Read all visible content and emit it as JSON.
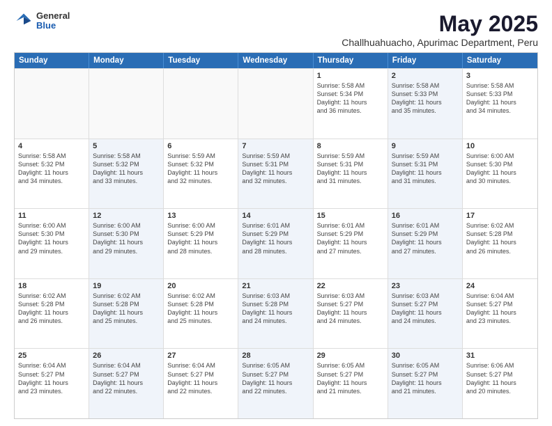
{
  "logo": {
    "general": "General",
    "blue": "Blue"
  },
  "title": "May 2025",
  "subtitle": "Challhuahuacho, Apurimac Department, Peru",
  "header_days": [
    "Sunday",
    "Monday",
    "Tuesday",
    "Wednesday",
    "Thursday",
    "Friday",
    "Saturday"
  ],
  "rows": [
    [
      {
        "day": "",
        "info": "",
        "empty": true
      },
      {
        "day": "",
        "info": "",
        "empty": true
      },
      {
        "day": "",
        "info": "",
        "empty": true
      },
      {
        "day": "",
        "info": "",
        "empty": true
      },
      {
        "day": "1",
        "info": "Sunrise: 5:58 AM\nSunset: 5:34 PM\nDaylight: 11 hours\nand 36 minutes."
      },
      {
        "day": "2",
        "info": "Sunrise: 5:58 AM\nSunset: 5:33 PM\nDaylight: 11 hours\nand 35 minutes.",
        "shaded": true
      },
      {
        "day": "3",
        "info": "Sunrise: 5:58 AM\nSunset: 5:33 PM\nDaylight: 11 hours\nand 34 minutes."
      }
    ],
    [
      {
        "day": "4",
        "info": "Sunrise: 5:58 AM\nSunset: 5:32 PM\nDaylight: 11 hours\nand 34 minutes."
      },
      {
        "day": "5",
        "info": "Sunrise: 5:58 AM\nSunset: 5:32 PM\nDaylight: 11 hours\nand 33 minutes.",
        "shaded": true
      },
      {
        "day": "6",
        "info": "Sunrise: 5:59 AM\nSunset: 5:32 PM\nDaylight: 11 hours\nand 32 minutes."
      },
      {
        "day": "7",
        "info": "Sunrise: 5:59 AM\nSunset: 5:31 PM\nDaylight: 11 hours\nand 32 minutes.",
        "shaded": true
      },
      {
        "day": "8",
        "info": "Sunrise: 5:59 AM\nSunset: 5:31 PM\nDaylight: 11 hours\nand 31 minutes."
      },
      {
        "day": "9",
        "info": "Sunrise: 5:59 AM\nSunset: 5:31 PM\nDaylight: 11 hours\nand 31 minutes.",
        "shaded": true
      },
      {
        "day": "10",
        "info": "Sunrise: 6:00 AM\nSunset: 5:30 PM\nDaylight: 11 hours\nand 30 minutes."
      }
    ],
    [
      {
        "day": "11",
        "info": "Sunrise: 6:00 AM\nSunset: 5:30 PM\nDaylight: 11 hours\nand 29 minutes."
      },
      {
        "day": "12",
        "info": "Sunrise: 6:00 AM\nSunset: 5:30 PM\nDaylight: 11 hours\nand 29 minutes.",
        "shaded": true
      },
      {
        "day": "13",
        "info": "Sunrise: 6:00 AM\nSunset: 5:29 PM\nDaylight: 11 hours\nand 28 minutes."
      },
      {
        "day": "14",
        "info": "Sunrise: 6:01 AM\nSunset: 5:29 PM\nDaylight: 11 hours\nand 28 minutes.",
        "shaded": true
      },
      {
        "day": "15",
        "info": "Sunrise: 6:01 AM\nSunset: 5:29 PM\nDaylight: 11 hours\nand 27 minutes."
      },
      {
        "day": "16",
        "info": "Sunrise: 6:01 AM\nSunset: 5:29 PM\nDaylight: 11 hours\nand 27 minutes.",
        "shaded": true
      },
      {
        "day": "17",
        "info": "Sunrise: 6:02 AM\nSunset: 5:28 PM\nDaylight: 11 hours\nand 26 minutes."
      }
    ],
    [
      {
        "day": "18",
        "info": "Sunrise: 6:02 AM\nSunset: 5:28 PM\nDaylight: 11 hours\nand 26 minutes."
      },
      {
        "day": "19",
        "info": "Sunrise: 6:02 AM\nSunset: 5:28 PM\nDaylight: 11 hours\nand 25 minutes.",
        "shaded": true
      },
      {
        "day": "20",
        "info": "Sunrise: 6:02 AM\nSunset: 5:28 PM\nDaylight: 11 hours\nand 25 minutes."
      },
      {
        "day": "21",
        "info": "Sunrise: 6:03 AM\nSunset: 5:28 PM\nDaylight: 11 hours\nand 24 minutes.",
        "shaded": true
      },
      {
        "day": "22",
        "info": "Sunrise: 6:03 AM\nSunset: 5:27 PM\nDaylight: 11 hours\nand 24 minutes."
      },
      {
        "day": "23",
        "info": "Sunrise: 6:03 AM\nSunset: 5:27 PM\nDaylight: 11 hours\nand 24 minutes.",
        "shaded": true
      },
      {
        "day": "24",
        "info": "Sunrise: 6:04 AM\nSunset: 5:27 PM\nDaylight: 11 hours\nand 23 minutes."
      }
    ],
    [
      {
        "day": "25",
        "info": "Sunrise: 6:04 AM\nSunset: 5:27 PM\nDaylight: 11 hours\nand 23 minutes."
      },
      {
        "day": "26",
        "info": "Sunrise: 6:04 AM\nSunset: 5:27 PM\nDaylight: 11 hours\nand 22 minutes.",
        "shaded": true
      },
      {
        "day": "27",
        "info": "Sunrise: 6:04 AM\nSunset: 5:27 PM\nDaylight: 11 hours\nand 22 minutes."
      },
      {
        "day": "28",
        "info": "Sunrise: 6:05 AM\nSunset: 5:27 PM\nDaylight: 11 hours\nand 22 minutes.",
        "shaded": true
      },
      {
        "day": "29",
        "info": "Sunrise: 6:05 AM\nSunset: 5:27 PM\nDaylight: 11 hours\nand 21 minutes."
      },
      {
        "day": "30",
        "info": "Sunrise: 6:05 AM\nSunset: 5:27 PM\nDaylight: 11 hours\nand 21 minutes.",
        "shaded": true
      },
      {
        "day": "31",
        "info": "Sunrise: 6:06 AM\nSunset: 5:27 PM\nDaylight: 11 hours\nand 20 minutes."
      }
    ]
  ]
}
